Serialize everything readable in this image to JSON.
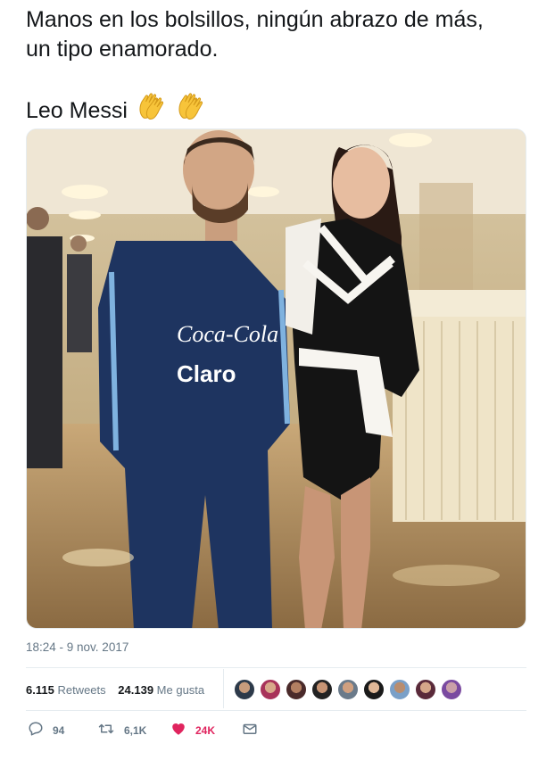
{
  "tweet": {
    "line1": "Manos en los bolsillos, ningún abrazo de más,",
    "line2": "un tipo enamorado.",
    "line3": "Leo Messi",
    "emoji": [
      "clapping-hands-icon",
      "clapping-hands-icon"
    ]
  },
  "timestamp": "18:24 - 9 nov. 2017",
  "stats": {
    "retweets_count": "6.115",
    "retweets_label": "Retweets",
    "likes_count": "24.139",
    "likes_label": "Me gusta"
  },
  "actions": {
    "reply_count": "94",
    "retweet_count": "6,1K",
    "like_count": "24K"
  },
  "colors": {
    "text": "#14171a",
    "muted": "#657786",
    "like": "#e0245e",
    "divider": "#e6ecf0"
  }
}
